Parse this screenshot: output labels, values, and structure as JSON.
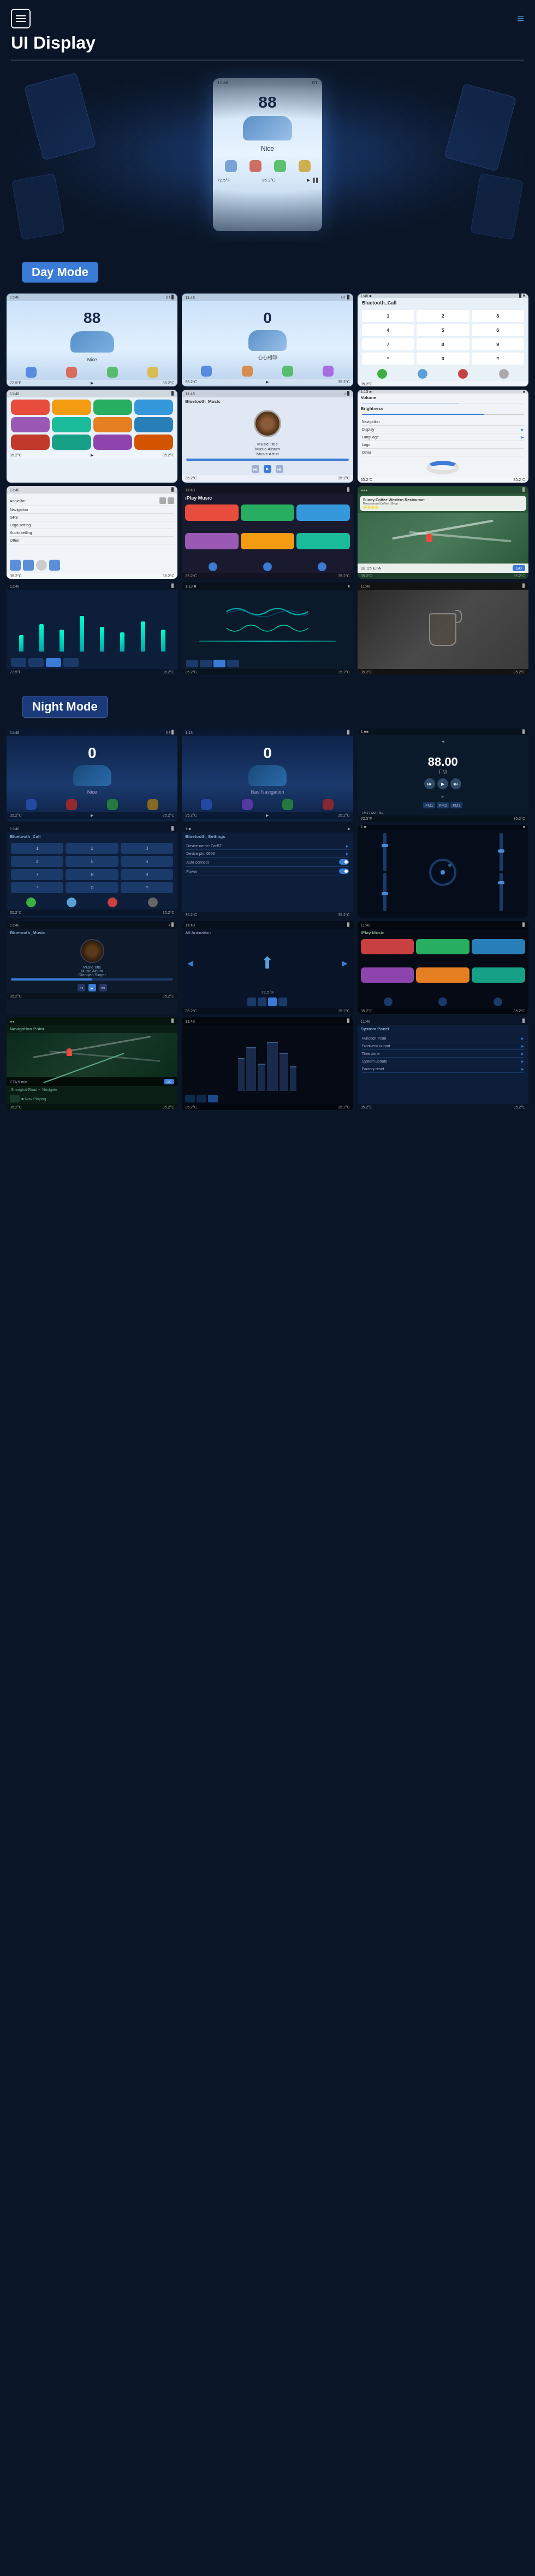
{
  "header": {
    "menu_icon": "≡",
    "nav_icon": "≡",
    "title": "UI Display"
  },
  "sections": {
    "day_mode": {
      "label": "Day Mode"
    },
    "night_mode": {
      "label": "Night Mode"
    }
  },
  "day_screens": {
    "row1": [
      {
        "type": "home",
        "number": "88",
        "label": "Nice",
        "temp_left": "72.5°F",
        "temp_right": "35.2°C"
      },
      {
        "type": "home2",
        "number": "0",
        "label": "心心相印",
        "temp_left": "35.2°C",
        "temp_right": "35.2°C"
      },
      {
        "type": "call",
        "title": "Bluetooth_Call",
        "temp_left": "35.2°C",
        "temp_right": ""
      }
    ],
    "row2": [
      {
        "type": "apps",
        "temp_left": "35.2°C",
        "temp_right": "35.2°C"
      },
      {
        "type": "music",
        "title": "Bluetooth_Music",
        "song": "Music Title",
        "album": "Music Album",
        "artist": "Music Artist",
        "temp_left": "35.2°C",
        "temp_right": "35.2°C"
      },
      {
        "type": "settings",
        "temp_left": "35.2°C",
        "temp_right": "35.2°C"
      }
    ],
    "row3": [
      {
        "type": "nav_settings",
        "temp_left": "35.2°C",
        "temp_right": "35.2°C"
      },
      {
        "type": "carplay",
        "temp_left": "35.2°C",
        "temp_right": "35.2°C"
      },
      {
        "type": "map",
        "title": "Sunny Coffee Western Restaurant",
        "temp_left": "35.2°C",
        "temp_right": "35.2°C"
      }
    ],
    "row4": [
      {
        "type": "eq1",
        "temp_left": "72.5°F",
        "temp_right": "35.2°C"
      },
      {
        "type": "eq2",
        "temp_left": "35.2°C",
        "temp_right": "35.2°C"
      },
      {
        "type": "tea",
        "temp_left": "35.2°C",
        "temp_right": "35.2°C"
      }
    ]
  },
  "night_screens": {
    "row1": [
      {
        "type": "home_night",
        "number": "0",
        "temp_left": "35.2°C",
        "temp_right": "35.2°C"
      },
      {
        "type": "home_night2",
        "number": "0",
        "temp_left": "35.2°C",
        "temp_right": "35.2°C"
      },
      {
        "type": "radio_night",
        "freq": "88.00",
        "unit": "FM",
        "temp_left": "72.5°F",
        "temp_right": "35.2°C"
      }
    ],
    "row2": [
      {
        "type": "call_night",
        "title": "Bluetooth_Call",
        "temp_left": "35.2°C",
        "temp_right": "35.2°C"
      },
      {
        "type": "settings_night",
        "title": "Bluetooth_Settings",
        "temp_left": "35.2°C",
        "temp_right": "35.2°C"
      },
      {
        "type": "eq_night",
        "temp_left": "35.2°C",
        "temp_right": "35.2°C"
      }
    ],
    "row3": [
      {
        "type": "music_night",
        "title": "Bluetooth_Music",
        "song": "Music Title",
        "album": "Music Album",
        "artist": "Qianqian Singer",
        "temp_left": "35.2°C",
        "temp_right": "35.2°C"
      },
      {
        "type": "nav_night",
        "temp_left": "35.2°C",
        "temp_right": "35.2°C"
      },
      {
        "type": "carplay_night",
        "temp_left": "35.2°C",
        "temp_right": "35.2°C"
      }
    ],
    "row4": [
      {
        "type": "map_night",
        "title": "Navigation Point",
        "temp_left": "35.2°C",
        "temp_right": "35.2°C"
      },
      {
        "type": "building_night",
        "temp_left": "35.2°C",
        "temp_right": "35.2°C"
      },
      {
        "type": "settings2_night",
        "temp_left": "35.2°C",
        "temp_right": "35.2°C"
      }
    ]
  },
  "colors": {
    "background": "#0a1628",
    "day_label_bg": "#3a7bd5",
    "night_label_bg": "#1a3a7a",
    "accent": "#4a90d9"
  }
}
